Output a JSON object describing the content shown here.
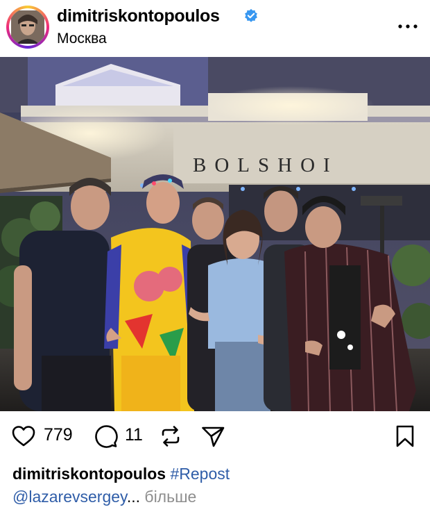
{
  "header": {
    "username": "dimitriskontopoulos",
    "location": "Москва",
    "verified": true
  },
  "photo": {
    "sign_text": "BOLSHOI"
  },
  "actions": {
    "likes": "779",
    "comments": "11"
  },
  "caption": {
    "username": "dimitriskontopoulos",
    "hashtag": "#Repost",
    "mention": "@lazarevsergey",
    "ellipsis": "...",
    "more_label": "більше"
  },
  "colors": {
    "verified_badge": "#3897f0",
    "link": "#2f5da8",
    "muted": "#8e8e8e"
  },
  "icons": [
    "verified-badge-icon",
    "more-options-icon",
    "heart-icon",
    "comment-icon",
    "repost-icon",
    "share-icon",
    "bookmark-icon"
  ]
}
